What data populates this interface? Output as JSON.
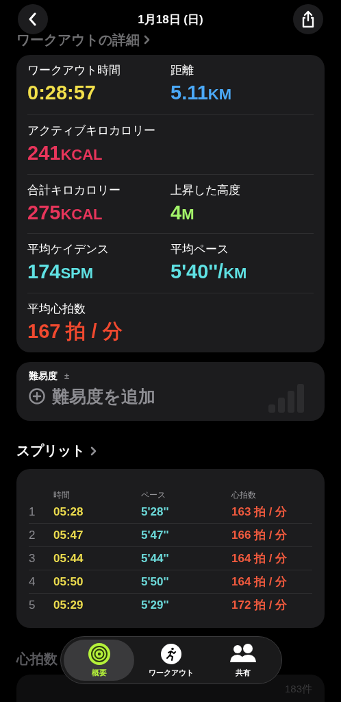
{
  "header": {
    "title": "1月18日 (日)"
  },
  "details": {
    "heading": "ワークアウトの詳細",
    "rows": [
      [
        {
          "label": "ワークアウト時間",
          "value": "0:28:57",
          "color": "#f2e04b"
        },
        {
          "label": "距離",
          "value": "5.11",
          "unit": "KM",
          "color": "#4ba9f7"
        }
      ],
      [
        {
          "label": "アクティブキロカロリー",
          "value": "241",
          "unit": "KCAL",
          "color": "#e8355b"
        }
      ],
      [
        {
          "label": "合計キロカロリー",
          "value": "275",
          "unit": "KCAL",
          "color": "#e8355b"
        },
        {
          "label": "上昇した高度",
          "value": "4",
          "unit": "M",
          "color": "#a4f56a"
        }
      ],
      [
        {
          "label": "平均ケイデンス",
          "value": "174",
          "unit": "SPM",
          "color": "#5fe1e3"
        },
        {
          "label": "平均ペース",
          "value": "5'40''/",
          "unit": "KM",
          "color": "#5fe1e3"
        }
      ],
      [
        {
          "label": "平均心拍数",
          "value": "167 拍 / 分",
          "color": "#f0492f"
        }
      ]
    ]
  },
  "difficulty": {
    "label": "難易度",
    "label_mark": "±",
    "action": "難易度を追加"
  },
  "splits": {
    "heading": "スプリット",
    "columns": [
      "時間",
      "ペース",
      "心拍数"
    ],
    "rows": [
      {
        "index": "1",
        "time": "05:28",
        "pace": "5'28''",
        "heart_rate": "163 拍 / 分"
      },
      {
        "index": "2",
        "time": "05:47",
        "pace": "5'47''",
        "heart_rate": "166 拍 / 分"
      },
      {
        "index": "3",
        "time": "05:44",
        "pace": "5'44''",
        "heart_rate": "164 拍 / 分"
      },
      {
        "index": "4",
        "time": "05:50",
        "pace": "5'50''",
        "heart_rate": "164 拍 / 分"
      },
      {
        "index": "5",
        "time": "05:29",
        "pace": "5'29''",
        "heart_rate": "172 拍 / 分"
      }
    ]
  },
  "heart_rate": {
    "heading": "心拍数",
    "count": "183件"
  },
  "tabs": [
    {
      "label": "概要",
      "kind": "rings",
      "selected": true
    },
    {
      "label": "ワークアウト",
      "kind": "runner",
      "selected": false
    },
    {
      "label": "共有",
      "kind": "people",
      "selected": false
    }
  ]
}
